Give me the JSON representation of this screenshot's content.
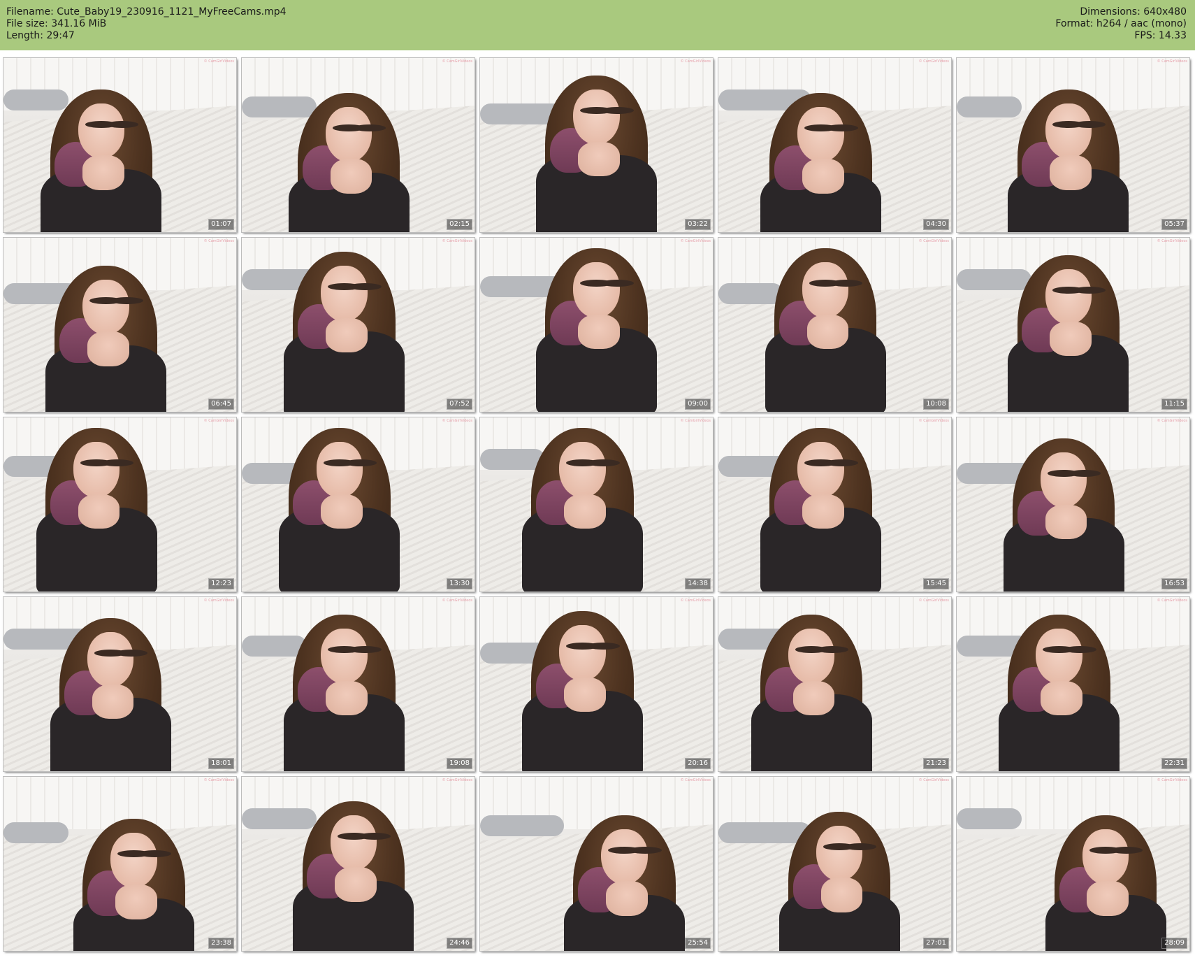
{
  "header": {
    "filename_line": "Filename: Cute_Baby19_230916_1121_MyFreeCams.mp4",
    "filesize_line": "File size: 341.16 MiB",
    "length_line": "Length: 29:47",
    "dimensions_line": "Dimensions: 640x480",
    "format_line": "Format: h264 / aac (mono)",
    "fps_line": "FPS: 14.33",
    "bar_color": "#a9c97e"
  },
  "thumbnails": [
    {
      "timestamp": "01:07"
    },
    {
      "timestamp": "02:15"
    },
    {
      "timestamp": "03:22"
    },
    {
      "timestamp": "04:30"
    },
    {
      "timestamp": "05:37"
    },
    {
      "timestamp": "06:45"
    },
    {
      "timestamp": "07:52"
    },
    {
      "timestamp": "09:00"
    },
    {
      "timestamp": "10:08"
    },
    {
      "timestamp": "11:15"
    },
    {
      "timestamp": "12:23"
    },
    {
      "timestamp": "13:30"
    },
    {
      "timestamp": "14:38"
    },
    {
      "timestamp": "15:45"
    },
    {
      "timestamp": "16:53"
    },
    {
      "timestamp": "18:01"
    },
    {
      "timestamp": "19:08"
    },
    {
      "timestamp": "20:16"
    },
    {
      "timestamp": "21:23"
    },
    {
      "timestamp": "22:31"
    },
    {
      "timestamp": "23:38"
    },
    {
      "timestamp": "24:46"
    },
    {
      "timestamp": "25:54"
    },
    {
      "timestamp": "27:01"
    },
    {
      "timestamp": "28:09"
    }
  ]
}
